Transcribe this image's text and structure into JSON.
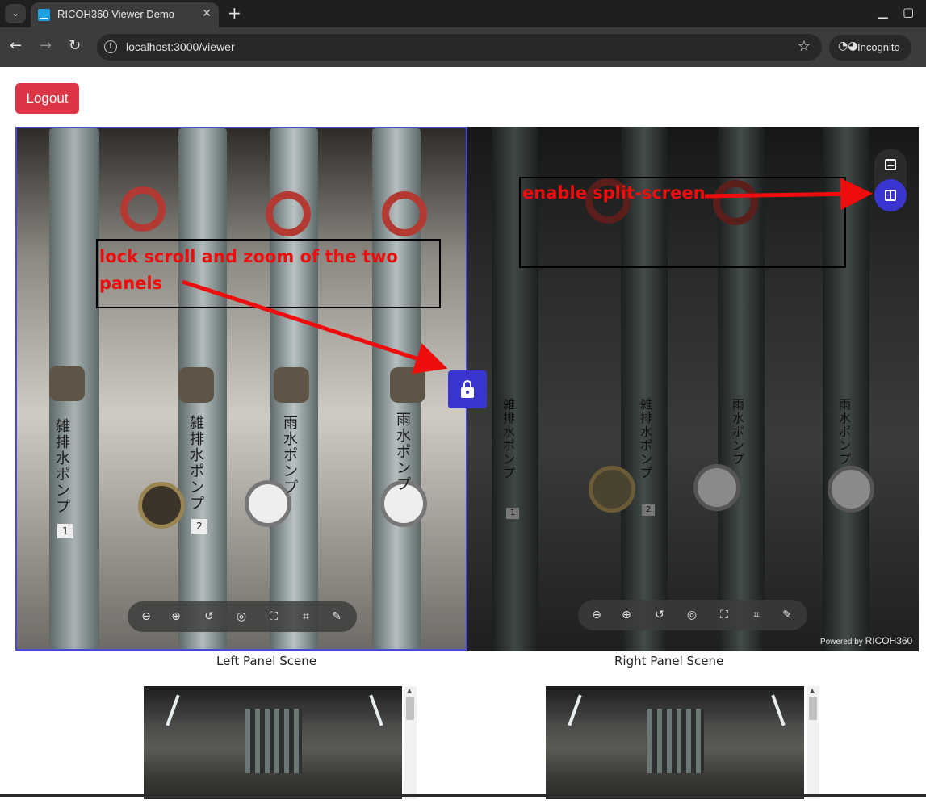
{
  "browser": {
    "tab_title": "RICOH360 Viewer Demo",
    "url": "localhost:3000/viewer",
    "incognito_label": "Incognito"
  },
  "page": {
    "logout_label": "Logout",
    "left_caption": "Left Panel Scene",
    "right_caption": "Right Panel Scene",
    "powered_prefix": "Powered by",
    "powered_brand": "RICOH360"
  },
  "left_scene_labels": {
    "pump1": "雑排水ポンプ",
    "pump2": "雑排水ポンプ",
    "pump3": "雨水ポンプ",
    "pump4": "雨水ポンプ",
    "tag1": "1",
    "tag2": "2"
  },
  "right_scene_labels": {
    "pump1": "雑排水ポンプ",
    "pump2": "雑排水ポンプ",
    "pump3": "雨水ポンプ",
    "pump4": "雨水ポンプ",
    "tag1": "1",
    "tag2": "2"
  },
  "annotations": {
    "lock": "lock scroll and zoom of the two panels",
    "split": "enable split-screen"
  },
  "colors": {
    "accent": "#3a35cf",
    "logout": "#dc3545",
    "annotation": "#ee0d0d"
  },
  "viewer_toolbar_icons": [
    "zoom-out-icon",
    "zoom-in-icon",
    "rotate-icon",
    "gyro-icon",
    "fullscreen-icon",
    "crop-icon",
    "edit-icon"
  ]
}
